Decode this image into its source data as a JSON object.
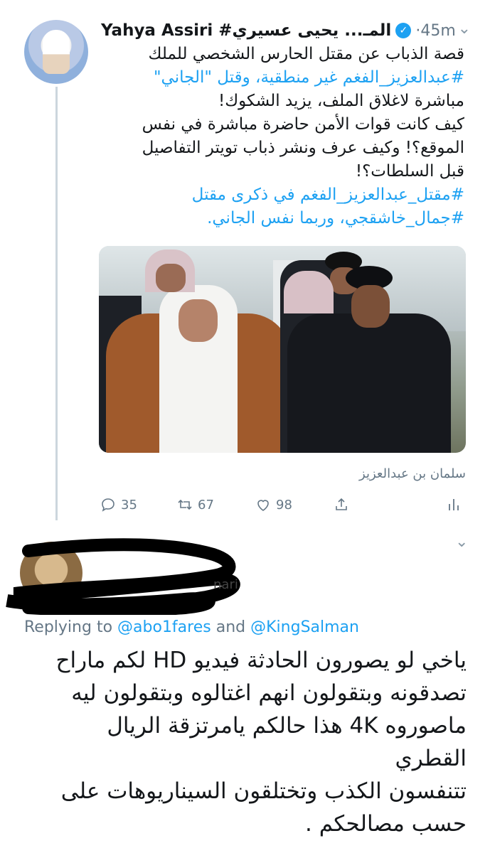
{
  "tweet": {
    "author_name": "Yahya Assiri #المـ... يحيى عسيري",
    "time": "45m",
    "text_lines": [
      "قصة الذباب عن مقتل الحارس الشخصي للملك",
      "#عبدالعزيز_الفغم غير منطقية، وقتل \"الجاني\"",
      "مباشرة لاغلاق الملف، يزيد الشكوك!",
      "كيف كانت قوات الأمن حاضرة مباشرة في نفس",
      "الموقع؟! وكيف عرف ونشر ذباب تويتر التفاصيل",
      "قبل السلطات؟!",
      "#مقتل_عبدالعزيز_الفغم في ذكرى مقتل",
      "#جمال_خاشقجي، وربما نفس الجاني."
    ],
    "image_caption": "سلمان بن عبدالعزيز",
    "replies_count": "35",
    "retweets_count": "67",
    "likes_count": "98"
  },
  "reply": {
    "name_residue": "nari",
    "replying_to_label": "Replying to",
    "mention_1": "@abo1fares",
    "and_label": "and",
    "mention_2": "@KingSalman",
    "text_lines": [
      "ياخي لو يصورون الحادثة فيديو HD لكم ماراح",
      "تصدقونه وبتقولون انهم اغتالوه وبتقولون ليه",
      "ماصوروه 4K هذا حالكم يامرتزقة الريال القطري",
      "تتنفسون الكذب وتختلقون السيناريوهات على",
      "حسب مصالحكم ."
    ]
  },
  "colors": {
    "accent": "#1da1f2",
    "secondary_text": "#657786",
    "primary_text": "#14171a",
    "thread_line": "#ccd6dd"
  },
  "icons": [
    "avatar",
    "verified-badge-icon",
    "chevron-down-icon",
    "reply-icon",
    "retweet-icon",
    "like-icon",
    "share-icon",
    "analytics-icon"
  ]
}
